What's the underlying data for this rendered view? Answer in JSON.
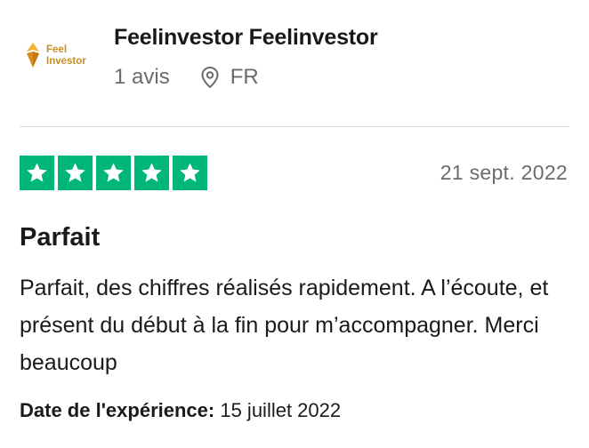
{
  "reviewer": {
    "logo_text_line1": "Feel",
    "logo_text_line2": "Investor",
    "name": "Feelinvestor Feelinvestor",
    "review_count": "1 avis",
    "country": "FR"
  },
  "rating": {
    "stars": 5,
    "max_stars": 5,
    "color": "#00b67a"
  },
  "review": {
    "date": "21 sept. 2022",
    "title": "Parfait",
    "text": "Parfait, des chiffres réalisés rapidement. A l’écoute, et présent du début à la fin pour m’accompagner. Merci beaucoup",
    "experience_label": "Date de l'expérience:",
    "experience_date": "15 juillet 2022"
  },
  "icons": {
    "location": "location-pin-icon",
    "star": "star-icon",
    "logo_mark": "diamond-logo-icon"
  }
}
